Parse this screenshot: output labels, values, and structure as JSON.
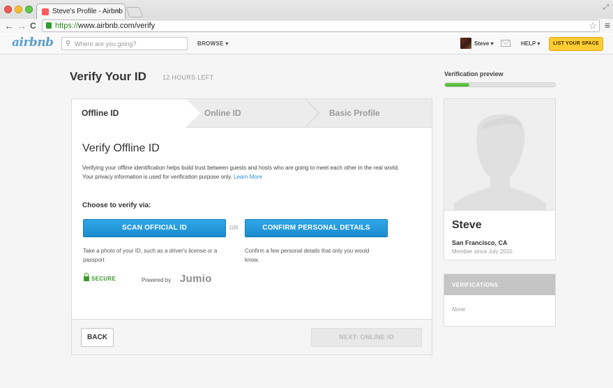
{
  "browser": {
    "tab_title": "Steve's Profile - Airbnb",
    "tab_close": "×",
    "url_scheme": "https://",
    "url_rest": "www.airbnb.com/verify",
    "back": "←",
    "forward": "→",
    "reload": "C",
    "star": "☆",
    "menu": "≡",
    "expand": "⤢"
  },
  "header": {
    "logo": "airbnb",
    "search_placeholder": "Where are you going?",
    "browse": "BROWSE ▾",
    "user": "Steve ▾",
    "help": "HELP ▾",
    "list_space": "LIST YOUR SPACE"
  },
  "page": {
    "title": "Verify Your ID",
    "hours_left": "12 HOURS LEFT"
  },
  "steps": [
    {
      "label": "Offline ID",
      "active": true
    },
    {
      "label": "Online ID",
      "active": false
    },
    {
      "label": "Basic Profile",
      "active": false
    }
  ],
  "offline": {
    "title": "Verify Offline ID",
    "description": "Verifying your offline identification helps build trust between guests and hosts who are going to meet each other in the real world. Your privacy information is used for verification purpose only.",
    "learn_more": "Learn More",
    "choose": "Choose to verify via:",
    "scan_button": "SCAN OFFICIAL ID",
    "or": "OR",
    "confirm_button": "CONFIRM PERSONAL DETAILS",
    "scan_hint": "Take a photo of your ID, such as a driver's license or a passport",
    "confirm_hint": "Confirm a few personal details that only you would know.",
    "secure": "SECURE",
    "powered_by": "Powered by",
    "jumio": "Jumio"
  },
  "footer": {
    "back": "BACK",
    "next": "NEXT: ONLINE ID"
  },
  "sidebar": {
    "preview_label": "Verification preview",
    "progress": 0.22,
    "name": "Steve",
    "location": "San Francisco, CA",
    "member_since": "Member since July 2010",
    "verifications_title": "VERIFICATIONS",
    "verifications_none": "None"
  },
  "colors": {
    "accent_blue": "#1b8ccd",
    "list_space_yellow": "#ffcc33",
    "progress_green": "#49b02b",
    "secure_green": "#3a9a2a"
  }
}
